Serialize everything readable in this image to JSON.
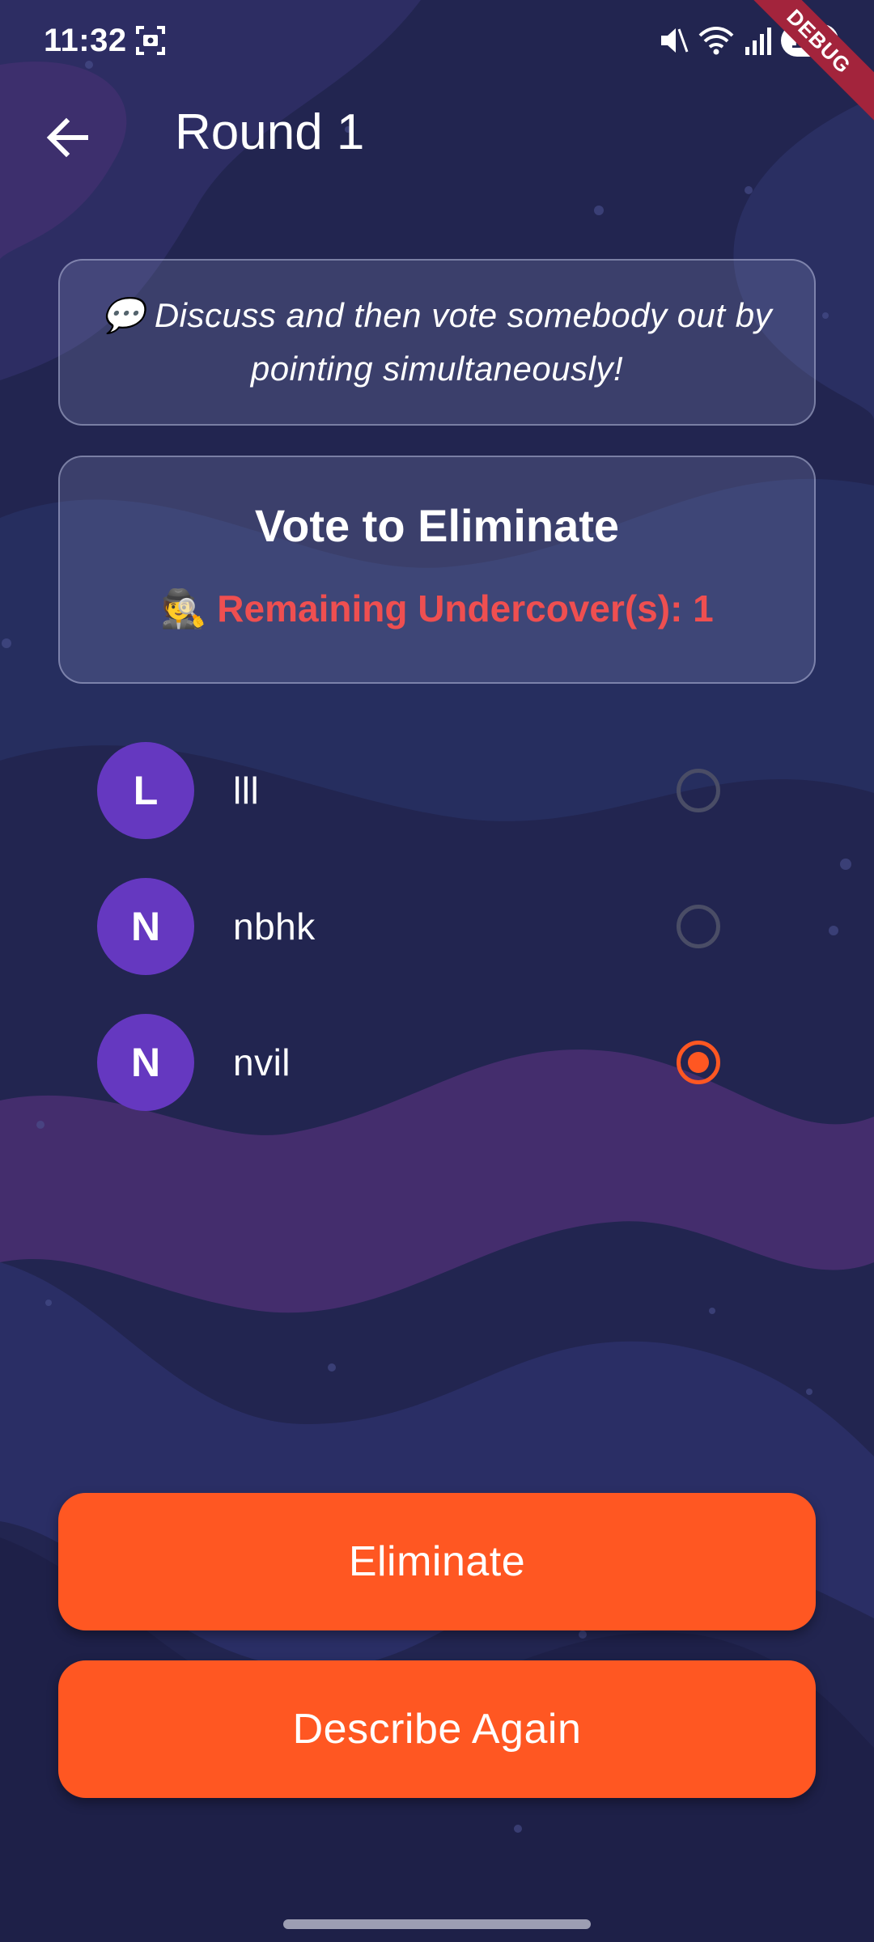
{
  "status_bar": {
    "time": "11:32",
    "battery": "100",
    "debug_banner": "DEBUG"
  },
  "app_bar": {
    "title": "Round 1",
    "back_icon": "arrow-left-icon"
  },
  "hint": {
    "emoji": "💬",
    "text": "Discuss and then vote somebody out by pointing simultaneously!"
  },
  "vote": {
    "title": "Vote to Eliminate",
    "emoji": "🕵️",
    "remaining": "Remaining Undercover(s): 1",
    "remaining_color": "#ef4f50"
  },
  "players": [
    {
      "initial": "L",
      "name": "lll",
      "selected": false
    },
    {
      "initial": "N",
      "name": "nbhk",
      "selected": false
    },
    {
      "initial": "N",
      "name": "nvil",
      "selected": true
    }
  ],
  "actions": {
    "eliminate": "Eliminate",
    "describe_again": "Describe Again"
  },
  "colors": {
    "accent": "#ff5722",
    "avatar": "#6538c0",
    "background": "#232650"
  }
}
